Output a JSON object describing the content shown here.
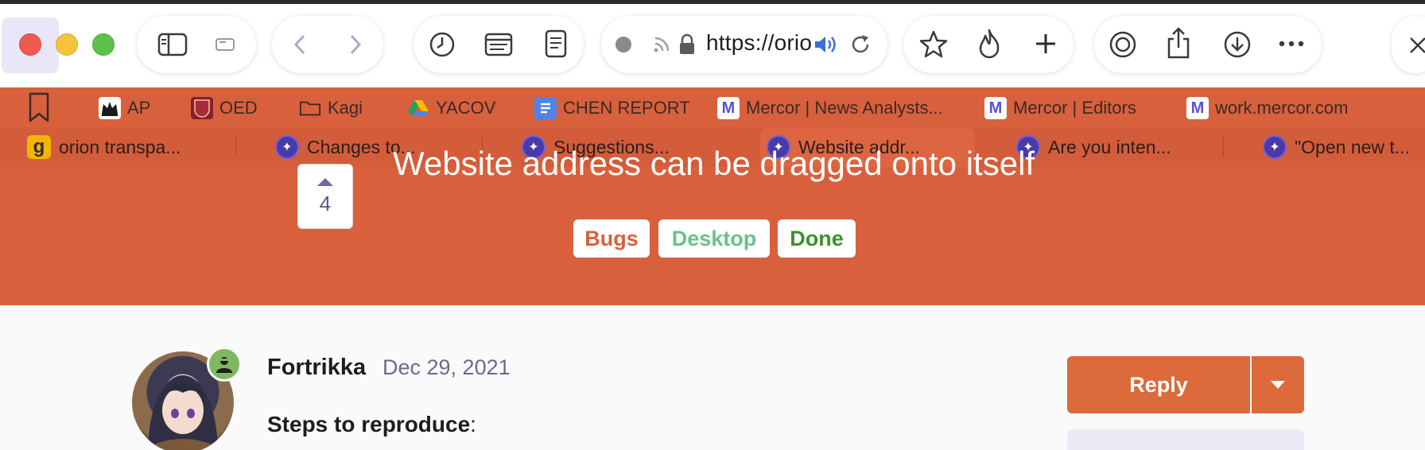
{
  "browser": {
    "url": "https://orio",
    "icons": [
      "sidebar-icon",
      "tab-overview-icon",
      "back-icon",
      "forward-icon",
      "history-icon",
      "reader-icon",
      "notes-icon",
      "record-icon",
      "rss-icon",
      "lock-icon",
      "audio-icon",
      "reload-icon",
      "star-icon",
      "flame-icon",
      "plus-icon",
      "extension-icon",
      "share-icon",
      "download-icon",
      "more-icon"
    ]
  },
  "bookmarks": [
    {
      "label": "AP",
      "icon": "crown-icon"
    },
    {
      "label": "OED",
      "icon": "oed-icon"
    },
    {
      "label": "Kagi",
      "icon": "folder-icon"
    },
    {
      "label": "YACOV",
      "icon": "drive-icon"
    },
    {
      "label": "CHEN REPORT",
      "icon": "docs-icon"
    },
    {
      "label": "Mercor | News Analysts...",
      "icon": "mercor-icon"
    },
    {
      "label": "Mercor | Editors",
      "icon": "mercor-icon"
    },
    {
      "label": "work.mercor.com",
      "icon": "mercor-icon"
    }
  ],
  "tabs": [
    {
      "label": "orion transpa...",
      "icon": "kagi-g-icon"
    },
    {
      "label": "Changes to...",
      "icon": "orion-icon"
    },
    {
      "label": "Suggestions...",
      "icon": "orion-icon"
    },
    {
      "label": "Website addr...",
      "icon": "orion-icon"
    },
    {
      "label": "Are you inten...",
      "icon": "orion-icon"
    },
    {
      "label": "\"Open new t...",
      "icon": "orion-icon"
    }
  ],
  "post": {
    "title": "Website address can be dragged onto itself",
    "votes": "4",
    "tags": [
      {
        "label": "Bugs",
        "color": "#d9603d"
      },
      {
        "label": "Desktop",
        "color": "#6cc08b"
      },
      {
        "label": "Done",
        "color": "#3f8f2e"
      }
    ],
    "author": "Fortrikka",
    "date": "Dec 29, 2021",
    "steps_label": "Steps to reproduce",
    "steps_suffix": ":",
    "reply_label": "Reply"
  },
  "colors": {
    "accent": "#d9603d",
    "reply": "#dc6a3a"
  }
}
